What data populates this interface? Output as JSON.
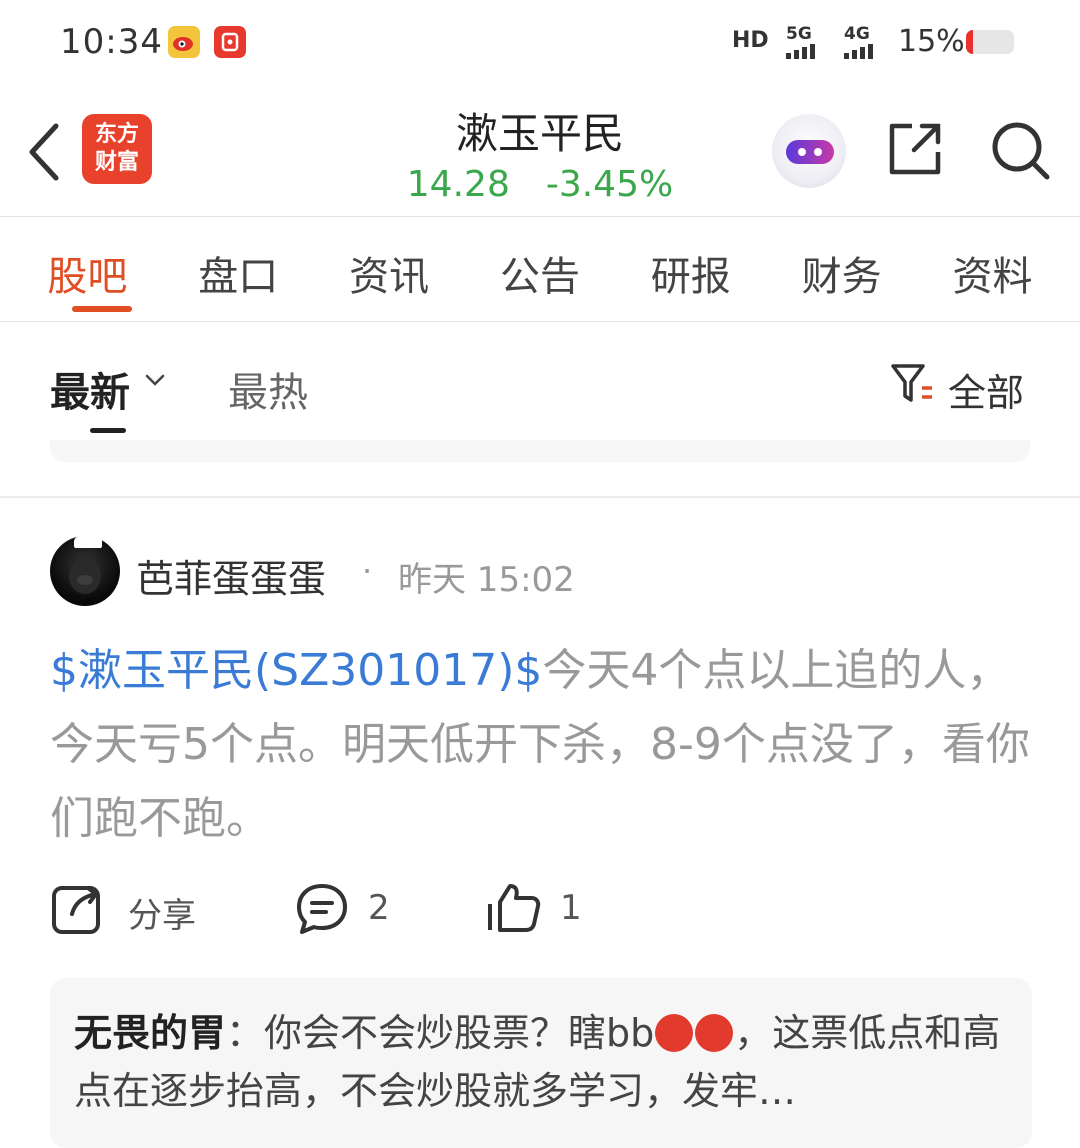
{
  "status_bar": {
    "time": "10:34",
    "hd": "HD",
    "net5g": "5G",
    "net4g": "4G",
    "battery_percent": "15%",
    "battery_level": 0.15,
    "battery_color": "#e9302c"
  },
  "header": {
    "brand_logo_line1": "东方",
    "brand_logo_line2": "财富",
    "stock_name": "漱玉平民",
    "price": "14.28",
    "change_percent": "-3.45%",
    "price_color": "#3aa84a"
  },
  "tabs": [
    {
      "label": "股吧",
      "active": true
    },
    {
      "label": "盘口"
    },
    {
      "label": "资讯"
    },
    {
      "label": "公告"
    },
    {
      "label": "研报"
    },
    {
      "label": "财务"
    },
    {
      "label": "资料"
    }
  ],
  "accent_color": "#e04e24",
  "sort": {
    "latest": "最新",
    "hot": "最热",
    "filter": "全部"
  },
  "post": {
    "author": "芭菲蛋蛋蛋",
    "separator": "·",
    "time": "昨天 15:02",
    "stock_tag": "$漱玉平民(SZ301017)$",
    "body": "今天4个点以上追的人，今天亏5个点。明天低开下杀，8-9个点没了，看你们跑不跑。",
    "tag_color": "#3a7bd5",
    "share_label": "分享",
    "comment_count": "2",
    "like_count": "1"
  },
  "comment_preview": {
    "author": "无畏的胃",
    "text_part1": "：你会不会炒股票？瞎bb",
    "text_part2": "，这票低点和高点在逐步抬高，不会炒股就多学习，发牢…"
  }
}
